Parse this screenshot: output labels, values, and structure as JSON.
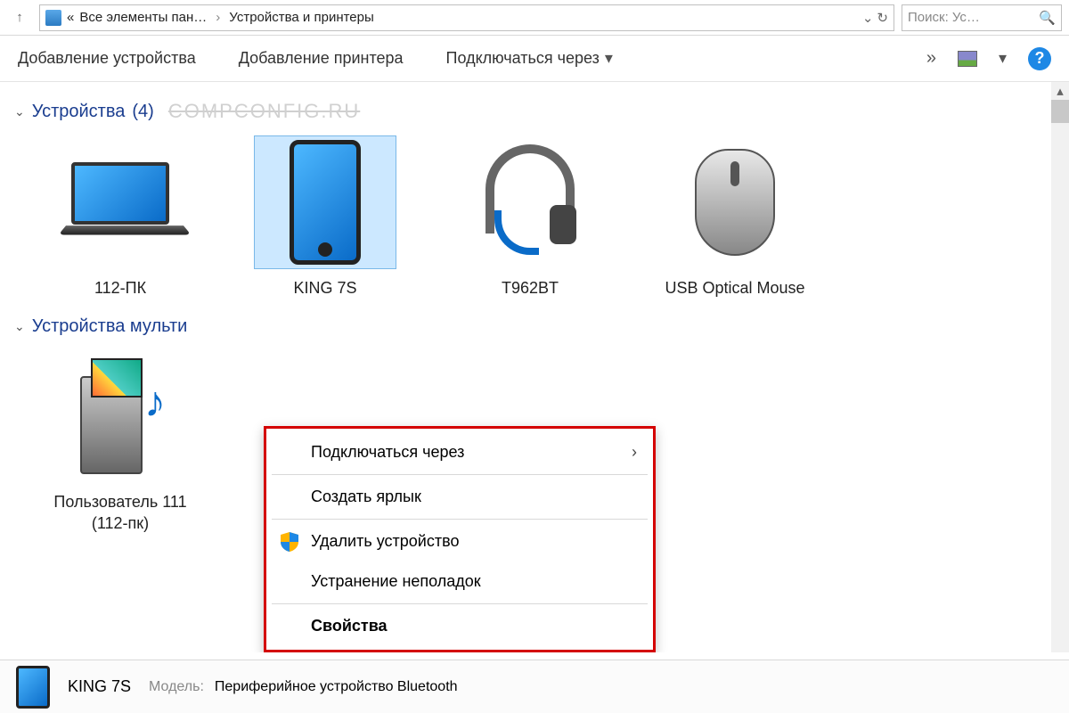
{
  "address_bar": {
    "up_tooltip": "↑",
    "breadcrumb_prefix": "«",
    "part1": "Все элементы пан…",
    "part2": "Устройства и принтеры"
  },
  "search": {
    "placeholder": "Поиск: Ус…"
  },
  "toolbar": {
    "add_device": "Добавление устройства",
    "add_printer": "Добавление принтера",
    "connect_via": "Подключаться через",
    "overflow": "»"
  },
  "sections": {
    "devices": {
      "title": "Устройства",
      "count": "(4)",
      "watermark": "COMPCONFIG.RU"
    },
    "multimedia": {
      "title": "Устройства мульти"
    }
  },
  "devices": [
    {
      "label": "112-ПК",
      "icon": "laptop"
    },
    {
      "label": "KING 7S",
      "icon": "phone",
      "selected": true
    },
    {
      "label": "T962BT",
      "icon": "headset"
    },
    {
      "label": "USB Optical Mouse",
      "icon": "mouse"
    }
  ],
  "multimedia_devices": [
    {
      "label": "Пользователь 111 (112-пк)",
      "icon": "media"
    }
  ],
  "context_menu": {
    "connect_via": "Подключаться через",
    "create_shortcut": "Создать ярлык",
    "remove_device": "Удалить устройство",
    "troubleshoot": "Устранение неполадок",
    "properties": "Свойства"
  },
  "details": {
    "name": "KING 7S",
    "model_label": "Модель:",
    "model_value": "Периферийное устройство Bluetooth"
  }
}
